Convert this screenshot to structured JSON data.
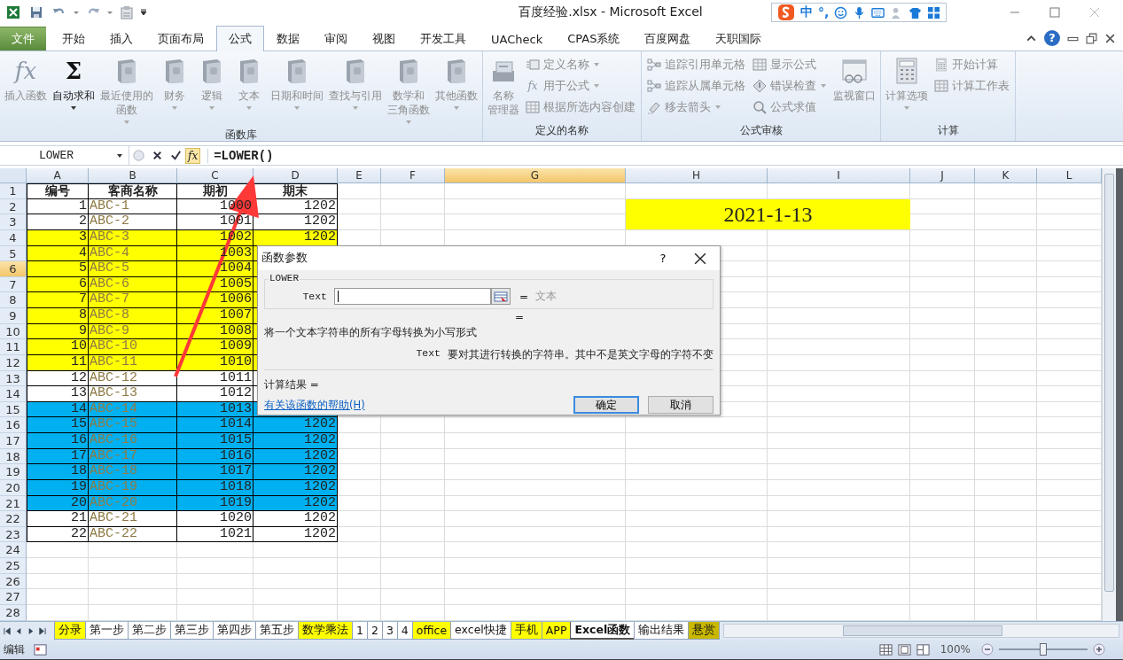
{
  "window": {
    "title": "百度经验.xlsx  -  Microsoft Excel"
  },
  "ime_toolbar": {
    "items": [
      "中",
      "°,"
    ]
  },
  "ribbon_tabs": [
    {
      "label": "文件",
      "kind": "file",
      "selected": false
    },
    {
      "label": "开始",
      "kind": "tab",
      "selected": false
    },
    {
      "label": "插入",
      "kind": "tab",
      "selected": false
    },
    {
      "label": "页面布局",
      "kind": "tab",
      "selected": false
    },
    {
      "label": "公式",
      "kind": "tab",
      "selected": true
    },
    {
      "label": "数据",
      "kind": "tab",
      "selected": false
    },
    {
      "label": "审阅",
      "kind": "tab",
      "selected": false
    },
    {
      "label": "视图",
      "kind": "tab",
      "selected": false
    },
    {
      "label": "开发工具",
      "kind": "tab",
      "selected": false
    },
    {
      "label": "UACheck",
      "kind": "tab",
      "selected": false
    },
    {
      "label": "CPAS系统",
      "kind": "tab",
      "selected": false
    },
    {
      "label": "百度网盘",
      "kind": "tab",
      "selected": false
    },
    {
      "label": "天职国际",
      "kind": "tab",
      "selected": false
    }
  ],
  "ribbon_help": "?",
  "ribbon_groups": [
    {
      "title": "函数库",
      "items": [
        {
          "kind": "large",
          "lines": [
            "插入函数"
          ],
          "glyph": "fx",
          "disabled": true
        },
        {
          "kind": "large",
          "lines": [
            "自动求和"
          ],
          "glyph": "Σ",
          "dropdown": true,
          "disabled": false
        },
        {
          "kind": "large",
          "lines": [
            "最近使用的",
            "函数"
          ],
          "dropdown": true,
          "disabled": true
        },
        {
          "kind": "large",
          "lines": [
            "财务"
          ],
          "dropdown": true,
          "disabled": true
        },
        {
          "kind": "large",
          "lines": [
            "逻辑"
          ],
          "dropdown": true,
          "disabled": true
        },
        {
          "kind": "large",
          "lines": [
            "文本"
          ],
          "dropdown": true,
          "disabled": true
        },
        {
          "kind": "large",
          "lines": [
            "日期和时间"
          ],
          "dropdown": true,
          "disabled": true
        },
        {
          "kind": "large",
          "lines": [
            "查找与引用"
          ],
          "dropdown": true,
          "disabled": true
        },
        {
          "kind": "large",
          "lines": [
            "数学和",
            "三角函数"
          ],
          "dropdown": true,
          "disabled": true
        },
        {
          "kind": "large",
          "lines": [
            "其他函数"
          ],
          "dropdown": true,
          "disabled": true
        }
      ]
    },
    {
      "title": "定义的名称",
      "items": [
        {
          "kind": "large",
          "lines": [
            "名称",
            "管理器"
          ],
          "disabled": true
        },
        {
          "kind": "small",
          "lines": [
            "定义名称"
          ],
          "dropdown": true,
          "disabled": true
        },
        {
          "kind": "small",
          "lines": [
            "用于公式"
          ],
          "glyph": "fx",
          "dropdown": true,
          "disabled": true
        },
        {
          "kind": "small",
          "lines": [
            "根据所选内容创建"
          ],
          "disabled": true
        }
      ]
    },
    {
      "title": "公式审核",
      "items": [
        {
          "kind": "small",
          "lines": [
            "追踪引用单元格"
          ],
          "disabled": true
        },
        {
          "kind": "small",
          "lines": [
            "追踪从属单元格"
          ],
          "disabled": true
        },
        {
          "kind": "small",
          "lines": [
            "移去箭头"
          ],
          "dropdown": true,
          "disabled": true
        },
        {
          "kind": "small",
          "lines": [
            "显示公式"
          ],
          "disabled": true
        },
        {
          "kind": "small",
          "lines": [
            "错误检查"
          ],
          "dropdown": true,
          "disabled": true
        },
        {
          "kind": "small",
          "lines": [
            "公式求值"
          ],
          "disabled": true
        },
        {
          "kind": "large",
          "lines": [
            "监视窗口"
          ],
          "disabled": true
        }
      ]
    },
    {
      "title": "计算",
      "items": [
        {
          "kind": "large",
          "lines": [
            "计算选项"
          ],
          "dropdown": true,
          "disabled": true
        },
        {
          "kind": "small",
          "lines": [
            "开始计算"
          ],
          "disabled": true
        },
        {
          "kind": "small",
          "lines": [
            "计算工作表"
          ],
          "disabled": true
        }
      ]
    }
  ],
  "formula_bar": {
    "name_box": "LOWER",
    "insert_function": "fx",
    "formula": "=LOWER()"
  },
  "sheet": {
    "columns": [
      {
        "label": "A",
        "selected": false
      },
      {
        "label": "B",
        "selected": false
      },
      {
        "label": "C",
        "selected": false
      },
      {
        "label": "D",
        "selected": false
      },
      {
        "label": "E",
        "selected": false
      },
      {
        "label": "F",
        "selected": false
      },
      {
        "label": "G",
        "selected": true
      },
      {
        "label": "H",
        "selected": false
      },
      {
        "label": "I",
        "selected": false
      },
      {
        "label": "J",
        "selected": false
      },
      {
        "label": "K",
        "selected": false
      },
      {
        "label": "L",
        "selected": false
      }
    ],
    "row_headers": [
      {
        "label": "1",
        "selected": false
      },
      {
        "label": "2",
        "selected": false
      },
      {
        "label": "3",
        "selected": false
      },
      {
        "label": "4",
        "selected": false
      },
      {
        "label": "5",
        "selected": false
      },
      {
        "label": "6",
        "selected": true
      },
      {
        "label": "7",
        "selected": false
      },
      {
        "label": "8",
        "selected": false
      },
      {
        "label": "9",
        "selected": false
      },
      {
        "label": "10",
        "selected": false
      },
      {
        "label": "11",
        "selected": false
      },
      {
        "label": "12",
        "selected": false
      },
      {
        "label": "13",
        "selected": false
      },
      {
        "label": "14",
        "selected": false
      },
      {
        "label": "15",
        "selected": false
      },
      {
        "label": "16",
        "selected": false
      },
      {
        "label": "17",
        "selected": false
      },
      {
        "label": "18",
        "selected": false
      },
      {
        "label": "19",
        "selected": false
      },
      {
        "label": "20",
        "selected": false
      },
      {
        "label": "21",
        "selected": false
      },
      {
        "label": "22",
        "selected": false
      },
      {
        "label": "23",
        "selected": false
      },
      {
        "label": "24",
        "selected": false
      },
      {
        "label": "25",
        "selected": false
      },
      {
        "label": "26",
        "selected": false
      },
      {
        "label": "27",
        "selected": false
      },
      {
        "label": "28",
        "selected": false
      }
    ],
    "header": [
      "编号",
      "客商名称",
      "期初",
      "期末"
    ],
    "rows": [
      {
        "cells": [
          "1",
          "ABC-1",
          "1000",
          "1202"
        ],
        "color": "#ffffff"
      },
      {
        "cells": [
          "2",
          "ABC-2",
          "1001",
          "1202"
        ],
        "color": "#ffffff"
      },
      {
        "cells": [
          "3",
          "ABC-3",
          "1002",
          "1202"
        ],
        "color": "#ffff00"
      },
      {
        "cells": [
          "4",
          "ABC-4",
          "1003"
        ],
        "color": "#ffff00"
      },
      {
        "cells": [
          "5",
          "ABC-5",
          "1004"
        ],
        "color": "#ffff00"
      },
      {
        "cells": [
          "6",
          "ABC-6",
          "1005"
        ],
        "color": "#ffff00"
      },
      {
        "cells": [
          "7",
          "ABC-7",
          "1006"
        ],
        "color": "#ffff00"
      },
      {
        "cells": [
          "8",
          "ABC-8",
          "1007"
        ],
        "color": "#ffff00"
      },
      {
        "cells": [
          "9",
          "ABC-9",
          "1008"
        ],
        "color": "#ffff00"
      },
      {
        "cells": [
          "10",
          "ABC-10",
          "1009"
        ],
        "color": "#ffff00"
      },
      {
        "cells": [
          "11",
          "ABC-11",
          "1010"
        ],
        "color": "#ffff00"
      },
      {
        "cells": [
          "12",
          "ABC-12",
          "1011"
        ],
        "color": "#ffffff"
      },
      {
        "cells": [
          "13",
          "ABC-13",
          "1012"
        ],
        "color": "#ffffff"
      },
      {
        "cells": [
          "14",
          "ABC-14",
          "1013"
        ],
        "color": "#00b0f0"
      },
      {
        "cells": [
          "15",
          "ABC-15",
          "1014",
          "1202"
        ],
        "color": "#00b0f0"
      },
      {
        "cells": [
          "16",
          "ABC-16",
          "1015",
          "1202"
        ],
        "color": "#00b0f0"
      },
      {
        "cells": [
          "17",
          "ABC-17",
          "1016",
          "1202"
        ],
        "color": "#00b0f0"
      },
      {
        "cells": [
          "18",
          "ABC-18",
          "1017",
          "1202"
        ],
        "color": "#00b0f0"
      },
      {
        "cells": [
          "19",
          "ABC-19",
          "1018",
          "1202"
        ],
        "color": "#00b0f0"
      },
      {
        "cells": [
          "20",
          "ABC-20",
          "1019",
          "1202"
        ],
        "color": "#00b0f0"
      },
      {
        "cells": [
          "21",
          "ABC-21",
          "1020",
          "1202"
        ],
        "color": "#ffffff"
      },
      {
        "cells": [
          "22",
          "ABC-22",
          "1021",
          "1202"
        ],
        "color": "#ffffff"
      }
    ],
    "date_cell": {
      "value": "2021-1-13"
    }
  },
  "dialog": {
    "title": "函数参数",
    "help": "?",
    "function_name": "LOWER",
    "argument_label": "Text",
    "equals": "=",
    "argument_result": "文本",
    "second_equals": "=",
    "description": "将一个文本字符串的所有字母转换为小写形式",
    "argument_help_label": "Text",
    "argument_help": "要对其进行转换的字符串。其中不是英文字母的字符不变",
    "result_label": "计算结果 =",
    "help_link": "有关该函数的帮助(H)",
    "buttons": [
      {
        "label": "确定",
        "default": true
      },
      {
        "label": "取消",
        "default": false
      }
    ]
  },
  "sheet_tabs": [
    {
      "label": "分录",
      "color": "#ffff00",
      "selected": false
    },
    {
      "label": "第一步",
      "color": "#ffffff",
      "selected": false
    },
    {
      "label": "第二步",
      "color": "#ffffff",
      "selected": false
    },
    {
      "label": "第三步",
      "color": "#ffffff",
      "selected": false
    },
    {
      "label": "第四步",
      "color": "#ffffff",
      "selected": false
    },
    {
      "label": "第五步",
      "color": "#ffffff",
      "selected": false
    },
    {
      "label": "数学乘法",
      "color": "#ffff00",
      "selected": false
    },
    {
      "label": "1",
      "color": "#ffffff",
      "selected": false
    },
    {
      "label": "2",
      "color": "#ffffff",
      "selected": false
    },
    {
      "label": "3",
      "color": "#ffffff",
      "selected": false
    },
    {
      "label": "4",
      "color": "#ffffff",
      "selected": false
    },
    {
      "label": "office",
      "color": "#ffff00",
      "selected": false
    },
    {
      "label": "excel快捷",
      "color": "#ffffff",
      "selected": false
    },
    {
      "label": "手机",
      "color": "#ffff00",
      "selected": false
    },
    {
      "label": "APP",
      "color": "#ffff00",
      "selected": false
    },
    {
      "label": "Excel函数",
      "color": "#ffffff",
      "selected": true
    },
    {
      "label": "输出结果",
      "color": "#ffffff",
      "selected": false
    },
    {
      "label": "悬赏",
      "color": "#c9b800",
      "selected": false
    }
  ],
  "status_bar": {
    "mode": "编辑",
    "zoom": {
      "label": "100%",
      "level": 0.5
    }
  }
}
